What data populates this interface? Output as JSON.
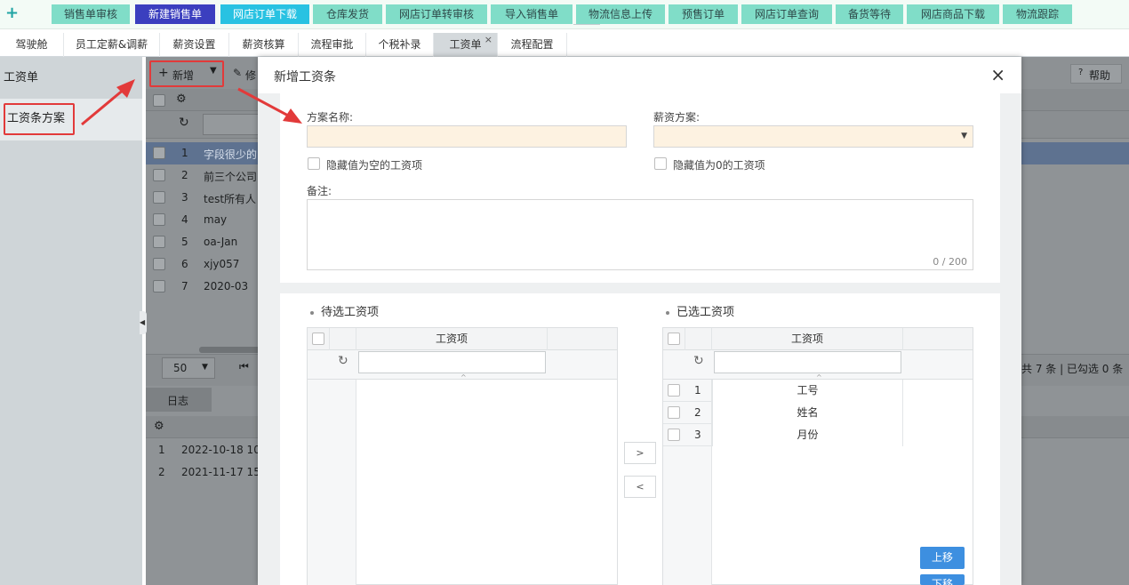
{
  "quickbar": {
    "add_icon": "plus-icon",
    "buttons": [
      "销售单审核",
      "新建销售单",
      "网店订单下载",
      "仓库发货",
      "网店订单转审核",
      "导入销售单",
      "物流信息上传",
      "预售订单",
      "网店订单查询",
      "备货等待",
      "网店商品下载",
      "物流跟踪"
    ],
    "colors": {
      "default": "#80ddc8",
      "purple": "#3b3fbf",
      "cyan": "#28c2e2"
    }
  },
  "tabs": [
    "驾驶舱",
    "员工定薪&调薪",
    "薪资设置",
    "薪资核算",
    "流程审批",
    "个税补录",
    "工资单",
    "流程配置"
  ],
  "active_tab_close": "×",
  "leftnav": {
    "items": [
      "工资单",
      "工资条方案"
    ]
  },
  "workspace": {
    "toolbar": {
      "add_label": "新增",
      "edit_label": "修",
      "help_label": "帮助"
    },
    "rows": [
      {
        "n": "1",
        "name": "字段很少的"
      },
      {
        "n": "2",
        "name": "前三个公司"
      },
      {
        "n": "3",
        "name": "test所有人"
      },
      {
        "n": "4",
        "name": "may"
      },
      {
        "n": "5",
        "name": "oa-Jan"
      },
      {
        "n": "6",
        "name": "xjy057"
      },
      {
        "n": "7",
        "name": "2020-03"
      }
    ],
    "page_size": "50",
    "summary": "共 7 条 | 已勾选 0 条",
    "log_tab": "日志",
    "log_rows": [
      {
        "n": "1",
        "time": "2022-10-18 10"
      },
      {
        "n": "2",
        "time": "2021-11-17 15"
      }
    ]
  },
  "modal": {
    "title": "新增工资条",
    "close": "×",
    "plan_name_label": "方案名称:",
    "plan_name_value": "",
    "salary_plan_label": "薪资方案:",
    "salary_plan_value": "",
    "hide_empty_label": "隐藏值为空的工资项",
    "hide_zero_label": "隐藏值为0的工资项",
    "remark_label": "备注:",
    "remark_counter": "0 / 200",
    "available_title": "待选工资项",
    "selected_title": "已选工资项",
    "column_header": "工资项",
    "move_right": ">",
    "move_left": "<",
    "selected_items": [
      {
        "n": "1",
        "name": "工号"
      },
      {
        "n": "2",
        "name": "姓名"
      },
      {
        "n": "3",
        "name": "月份"
      }
    ],
    "move_up": "上移",
    "move_down": "下移"
  }
}
